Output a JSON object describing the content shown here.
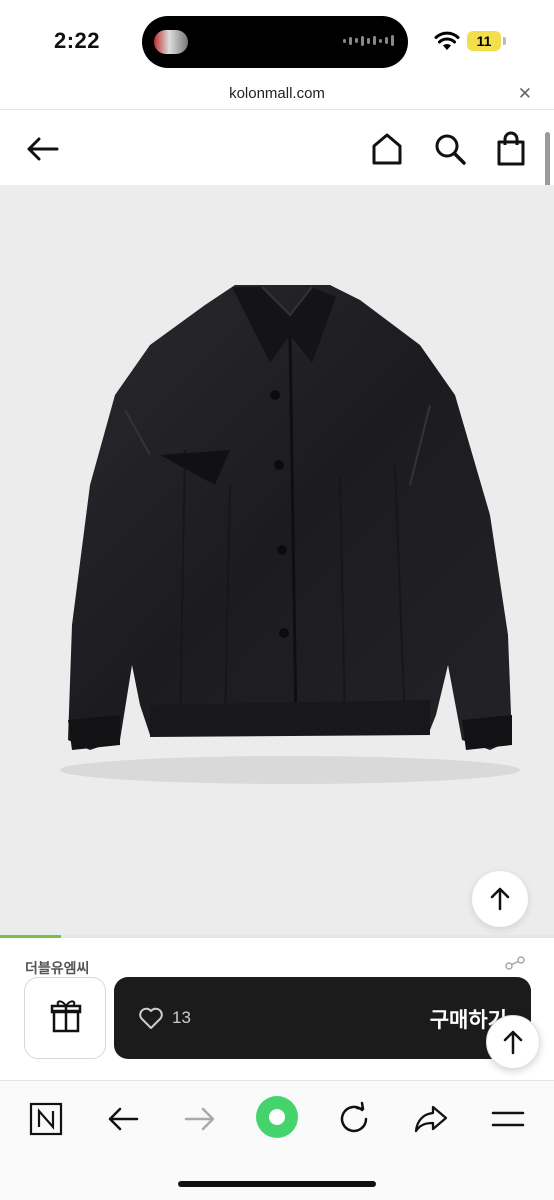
{
  "status_bar": {
    "time": "2:22",
    "battery": "11"
  },
  "browser": {
    "url": "kolonmall.com",
    "close_icon": "close-icon"
  },
  "site_header": {
    "back_icon": "arrow-left-icon",
    "home_icon": "home-icon",
    "search_icon": "search-icon",
    "bag_icon": "shopping-bag-icon"
  },
  "product": {
    "image_alt": "black jacket product photo",
    "image_progress": 0.11,
    "brand": "더블유엠씨"
  },
  "purchase_bar": {
    "like_count": "13",
    "buy_label": "구매하기"
  },
  "toolbar": {
    "items": [
      "naver-n-icon",
      "back-arrow-icon",
      "forward-arrow-icon",
      "green-dot-icon",
      "refresh-icon",
      "share-icon",
      "menu-icon"
    ]
  },
  "colors": {
    "accent_green": "#7cc04b",
    "buy_bar": "#1b1b1b",
    "image_bg": "#ececec"
  }
}
